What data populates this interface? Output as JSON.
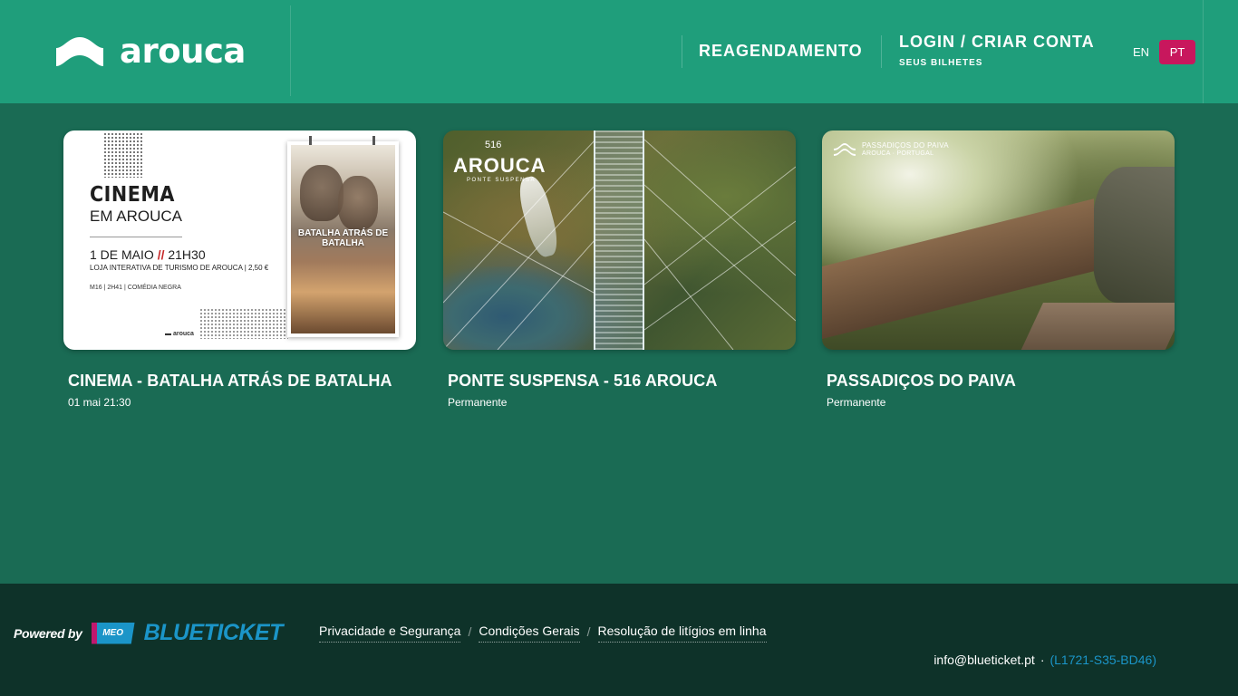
{
  "header": {
    "logo_text": "arouca",
    "nav": {
      "reagendamento": "REAGENDAMENTO",
      "login": "LOGIN / CRIAR CONTA",
      "login_sub": "SEUS BILHETES"
    },
    "languages": [
      {
        "code": "EN",
        "active": false
      },
      {
        "code": "PT",
        "active": true
      }
    ],
    "colors": {
      "header_bg": "#1f9e7b",
      "page_bg": "#1a6b54",
      "accent": "#c8175d"
    }
  },
  "events": [
    {
      "title": "CINEMA - BATALHA ATRÁS DE BATALHA",
      "date": "01 mai 21:30",
      "image": {
        "heading": "CINEMA",
        "subheading": "EM AROUCA",
        "date_line_day": "1 DE MAIO",
        "date_line_sep": "//",
        "date_line_time": "21H30",
        "location": "LOJA INTERATIVA DE TURISMO DE AROUCA | 2,50 €",
        "info": "M16  |  2H41  |  COMÉDIA NEGRA",
        "logo": "arouca",
        "poster_title": "BATALHA ATRÁS DE BATALHA"
      }
    },
    {
      "title": "PONTE SUSPENSA - 516 AROUCA",
      "date": "Permanente",
      "image": {
        "brand_number": "516",
        "brand": "AROUCA",
        "brand_sub": "PONTE SUSPENSA"
      }
    },
    {
      "title": "PASSADIÇOS DO PAIVA",
      "date": "Permanente",
      "image": {
        "brand_title": "PASSADIÇOS DO PAIVA",
        "brand_sub": "AROUCA · PORTUGAL"
      }
    }
  ],
  "footer": {
    "powered_by": "Powered by",
    "meo": "MEO",
    "blueticket": "BLUETICKET",
    "links": [
      "Privacidade e Segurança",
      "Condições Gerais",
      "Resolução de litígios em linha"
    ],
    "link_separator": "/",
    "email": "info@blueticket.pt",
    "contact_separator": "·",
    "code": "(L1721-S35-BD46)",
    "colors": {
      "footer_bg": "#0e3229",
      "brand_blue": "#1b95c8"
    }
  }
}
